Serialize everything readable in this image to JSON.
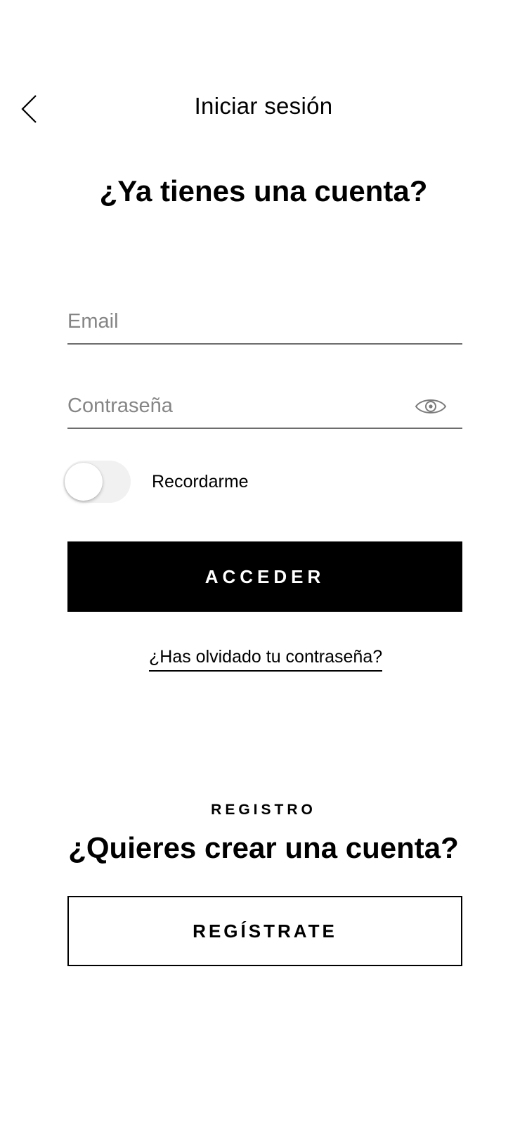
{
  "header": {
    "title": "Iniciar sesión",
    "back_icon": "chevron-left-icon"
  },
  "login": {
    "heading": "¿Ya tienes una cuenta?",
    "email": {
      "placeholder": "Email",
      "value": ""
    },
    "password": {
      "placeholder": "Contraseña",
      "value": "",
      "toggle_icon": "eye-icon"
    },
    "remember": {
      "label": "Recordarme",
      "enabled": false
    },
    "submit_label": "ACCEDER",
    "forgot_label": "¿Has olvidado tu contraseña?"
  },
  "register": {
    "section_label": "REGISTRO",
    "heading": "¿Quieres crear una cuenta?",
    "button_label": "REGÍSTRATE"
  },
  "colors": {
    "primary": "#000000",
    "background": "#ffffff",
    "placeholder": "#858585",
    "underline": "#6d6d6d",
    "toggle_track": "#f1f1f1"
  }
}
